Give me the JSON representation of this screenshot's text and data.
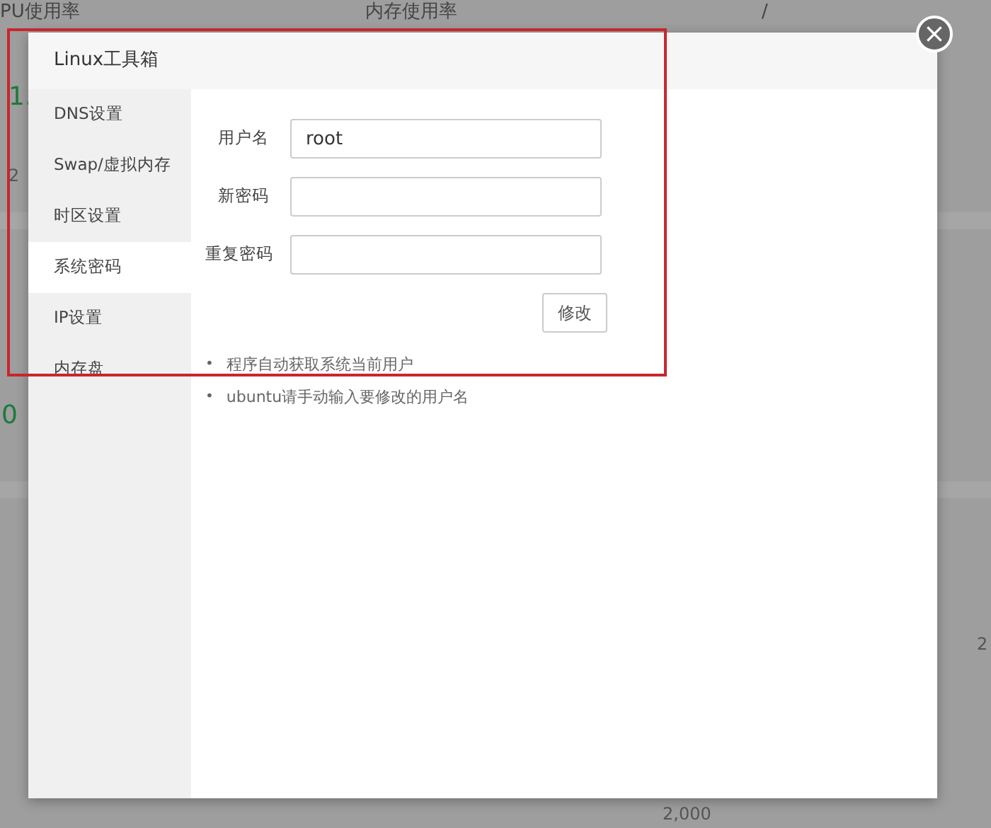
{
  "background": {
    "labels": [
      {
        "text": "PU使用率",
        "kind": "heading"
      },
      {
        "text": "内存使用率",
        "kind": "heading"
      },
      {
        "text": "/",
        "kind": "heading"
      },
      {
        "text": "1.",
        "kind": "value"
      },
      {
        "text": "2",
        "kind": "muted"
      },
      {
        "text": "0",
        "kind": "value"
      },
      {
        "text": "2",
        "kind": "muted"
      },
      {
        "text": "2,000",
        "kind": "muted"
      }
    ]
  },
  "modal": {
    "title": "Linux工具箱",
    "close": "×",
    "sidebar": {
      "items": [
        {
          "label": "DNS设置",
          "selected": false
        },
        {
          "label": "Swap/虚拟内存",
          "selected": false
        },
        {
          "label": "时区设置",
          "selected": false
        },
        {
          "label": "系统密码",
          "selected": true
        },
        {
          "label": "IP设置",
          "selected": false
        },
        {
          "label": "内存盘",
          "selected": false
        }
      ]
    },
    "form": {
      "fields": [
        {
          "label": "用户名",
          "value": "root"
        },
        {
          "label": "新密码"
        },
        {
          "label": "重复密码"
        }
      ],
      "submit": "修改"
    },
    "notes": [
      {
        "bullet": "•",
        "text": "程序自动获取系统当前用户"
      },
      {
        "bullet": "•",
        "text": "ubuntu请手动输入要修改的用户名"
      }
    ]
  },
  "annotation": {
    "kind": "highlight"
  }
}
